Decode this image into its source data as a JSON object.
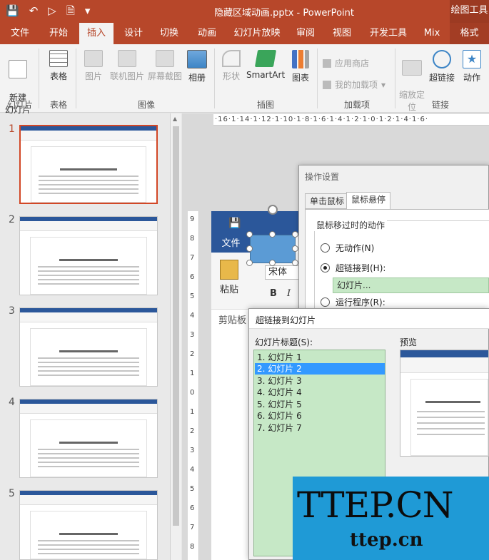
{
  "titlebar": {
    "doc_title": "隐藏区域动画.pptx - PowerPoint",
    "context_tools": "绘图工具"
  },
  "tabs": [
    {
      "label": "文件"
    },
    {
      "label": "开始"
    },
    {
      "label": "插入"
    },
    {
      "label": "设计"
    },
    {
      "label": "切换"
    },
    {
      "label": "动画"
    },
    {
      "label": "幻灯片放映"
    },
    {
      "label": "审阅"
    },
    {
      "label": "视图"
    },
    {
      "label": "开发工具"
    },
    {
      "label": "Mix"
    },
    {
      "label": "格式"
    }
  ],
  "ribbon": {
    "new_slide": "新建\n幻灯片",
    "table": "表格",
    "picture": "图片",
    "online_picture": "联机图片",
    "screenshot": "屏幕截图",
    "album": "相册",
    "shapes": "形状",
    "smartart": "SmartArt",
    "chart": "图表",
    "store": "应用商店",
    "my_addins": "我的加载项",
    "zoom": "缩放定\n位",
    "hyperlink": "超链接",
    "action": "动作",
    "groups": {
      "slides": "幻灯片",
      "tables": "表格",
      "images": "图像",
      "illustrations": "插图",
      "addins": "加载项",
      "links": "链接"
    }
  },
  "slide_numbers": [
    "1",
    "2",
    "3",
    "4",
    "5"
  ],
  "hruler_text": "·16·1·14·1·12·1·10·1·8·1·6·1·4·1·2·1·0·1·2·1·4·1·6·",
  "vruler_marks": [
    "9",
    "8",
    "7",
    "6",
    "5",
    "4",
    "3",
    "2",
    "1",
    "0",
    "1",
    "2",
    "3",
    "4",
    "5",
    "6",
    "7",
    "8"
  ],
  "word": {
    "file": "文件",
    "paste": "粘贴",
    "font": "宋体",
    "bold": "B",
    "italic": "I",
    "clipboard": "剪贴板"
  },
  "action_dialog": {
    "title": "操作设置",
    "tab_click": "单击鼠标",
    "tab_hover": "鼠标悬停",
    "section": "鼠标移过时的动作",
    "none": "无动作(N)",
    "hyperlink_to": "超链接到(H):",
    "hyperlink_value": "幻灯片...",
    "run_program": "运行程序(R):"
  },
  "link_dialog": {
    "title": "超链接到幻灯片",
    "list_label": "幻灯片标题(S):",
    "preview_label": "预览",
    "items": [
      "1. 幻灯片 1",
      "2. 幻灯片 2",
      "3. 幻灯片 3",
      "4. 幻灯片 4",
      "5. 幻灯片 5",
      "6. 幻灯片 6",
      "7. 幻灯片 7"
    ],
    "selected_index": 1
  },
  "watermark": {
    "big": "TTEP.CN",
    "small": "ttep.cn"
  },
  "colors": {
    "brand": "#b7472a",
    "word_blue": "#2b579a",
    "selection": "#3399ff",
    "list_bg": "#c6e8c6"
  }
}
